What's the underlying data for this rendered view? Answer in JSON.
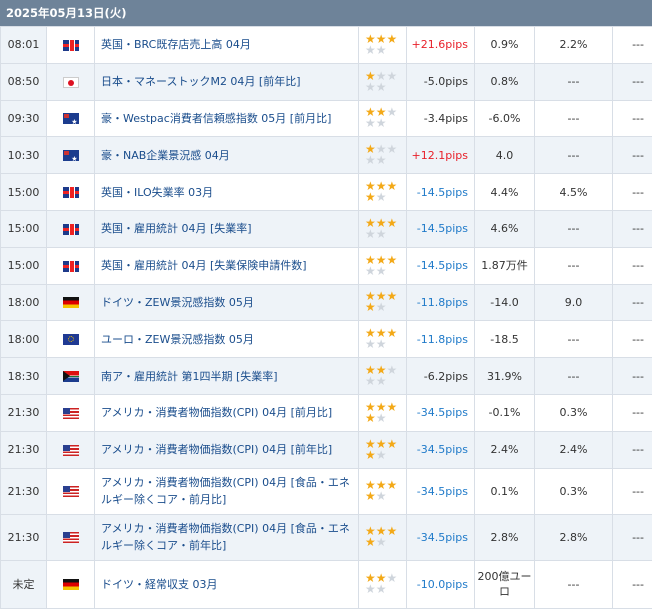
{
  "header": {
    "date": "2025年05月13日(火)"
  },
  "colors": {
    "header_bg": "#6e8399",
    "star_on": "#f3a918",
    "star_off": "#cfd5dc",
    "positive": "#e8202a",
    "negative": "#1f7ac9",
    "link": "#1a4d8c"
  },
  "rows": [
    {
      "time": "08:01",
      "flag": "uk-flag-icon",
      "name": "英国・BRC既存店売上高 04月",
      "stars": 3,
      "pips": "+21.6pips",
      "pips_sign": "pos",
      "previous": "0.9%",
      "forecast": "2.2%",
      "result": "---"
    },
    {
      "time": "08:50",
      "flag": "japan-flag-icon",
      "name": "日本・マネーストックM2 04月 [前年比]",
      "stars": 1,
      "pips": "-5.0pips",
      "pips_sign": "none",
      "previous": "0.8%",
      "forecast": "---",
      "result": "---"
    },
    {
      "time": "09:30",
      "flag": "australia-flag-icon",
      "name": "豪・Westpac消費者信頼感指数 05月 [前月比]",
      "stars": 2,
      "pips": "-3.4pips",
      "pips_sign": "none",
      "previous": "-6.0%",
      "forecast": "---",
      "result": "---"
    },
    {
      "time": "10:30",
      "flag": "australia-flag-icon",
      "name": "豪・NAB企業景況感 04月",
      "stars": 1,
      "pips": "+12.1pips",
      "pips_sign": "pos",
      "previous": "4.0",
      "forecast": "---",
      "result": "---"
    },
    {
      "time": "15:00",
      "flag": "uk-flag-icon",
      "name": "英国・ILO失業率 03月",
      "stars": 4,
      "pips": "-14.5pips",
      "pips_sign": "neg",
      "previous": "4.4%",
      "forecast": "4.5%",
      "result": "---"
    },
    {
      "time": "15:00",
      "flag": "uk-flag-icon",
      "name": "英国・雇用統計 04月 [失業率]",
      "stars": 3,
      "pips": "-14.5pips",
      "pips_sign": "neg",
      "previous": "4.6%",
      "forecast": "---",
      "result": "---"
    },
    {
      "time": "15:00",
      "flag": "uk-flag-icon",
      "name": "英国・雇用統計 04月 [失業保険申請件数]",
      "stars": 3,
      "pips": "-14.5pips",
      "pips_sign": "neg",
      "previous": "1.87万件",
      "forecast": "---",
      "result": "---"
    },
    {
      "time": "18:00",
      "flag": "germany-flag-icon",
      "name": "ドイツ・ZEW景況感指数 05月",
      "stars": 4,
      "pips": "-11.8pips",
      "pips_sign": "neg",
      "previous": "-14.0",
      "forecast": "9.0",
      "result": "---"
    },
    {
      "time": "18:00",
      "flag": "eu-flag-icon",
      "name": "ユーロ・ZEW景況感指数 05月",
      "stars": 3,
      "pips": "-11.8pips",
      "pips_sign": "neg",
      "previous": "-18.5",
      "forecast": "---",
      "result": "---"
    },
    {
      "time": "18:30",
      "flag": "south-africa-flag-icon",
      "name": "南ア・雇用統計 第1四半期 [失業率]",
      "stars": 2,
      "pips": "-6.2pips",
      "pips_sign": "none",
      "previous": "31.9%",
      "forecast": "---",
      "result": "---"
    },
    {
      "time": "21:30",
      "flag": "us-flag-icon",
      "name": "アメリカ・消費者物価指数(CPI) 04月 [前月比]",
      "stars": 4,
      "pips": "-34.5pips",
      "pips_sign": "neg",
      "previous": "-0.1%",
      "forecast": "0.3%",
      "result": "---"
    },
    {
      "time": "21:30",
      "flag": "us-flag-icon",
      "name": "アメリカ・消費者物価指数(CPI) 04月 [前年比]",
      "stars": 4,
      "pips": "-34.5pips",
      "pips_sign": "neg",
      "previous": "2.4%",
      "forecast": "2.4%",
      "result": "---"
    },
    {
      "time": "21:30",
      "flag": "us-flag-icon",
      "name": "アメリカ・消費者物価指数(CPI) 04月 [食品・エネルギー除くコア・前月比]",
      "stars": 4,
      "pips": "-34.5pips",
      "pips_sign": "neg",
      "previous": "0.1%",
      "forecast": "0.3%",
      "result": "---"
    },
    {
      "time": "21:30",
      "flag": "us-flag-icon",
      "name": "アメリカ・消費者物価指数(CPI) 04月 [食品・エネルギー除くコア・前年比]",
      "stars": 4,
      "pips": "-34.5pips",
      "pips_sign": "neg",
      "previous": "2.8%",
      "forecast": "2.8%",
      "result": "---"
    },
    {
      "time": "未定",
      "flag": "germany-flag-icon",
      "name": "ドイツ・経常収支 03月",
      "stars": 2,
      "pips": "-10.0pips",
      "pips_sign": "neg",
      "previous": "200億ユーロ",
      "forecast": "---",
      "result": "---"
    }
  ]
}
